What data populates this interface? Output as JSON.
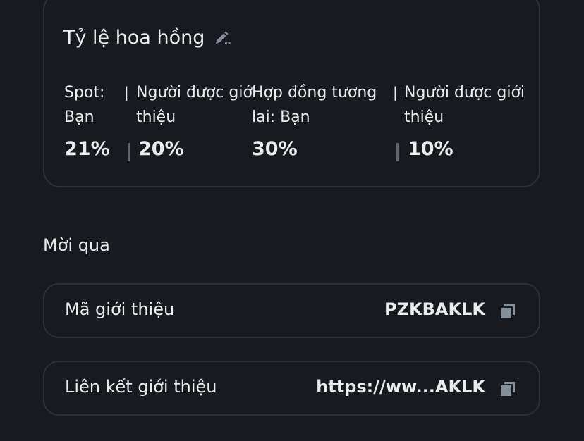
{
  "commission": {
    "title": "Tỷ lệ hoa hồng",
    "edit_icon": "edit-icon",
    "spot_label": "Spot:",
    "spot_you": "Bạn",
    "spot_sep": "|",
    "spot_referred_line1": "Người được giới",
    "spot_referred_line2": "thiệu",
    "spot_you_value": "21%",
    "spot_referred_value": "20%",
    "futures_line1": "Hợp đồng tương",
    "futures_line2": "lai: Bạn",
    "futures_sep": "|",
    "futures_referred_line1": "Người được giới",
    "futures_referred_line2": "thiệu",
    "futures_you_value": "30%",
    "futures_referred_value": "10%"
  },
  "invite": {
    "section_title": "Mời qua",
    "code_label": "Mã giới thiệu",
    "code_value": "PZKBAKLK",
    "link_label": "Liên kết giới thiệu",
    "link_value": "https://ww...AKLK",
    "copy_icon": "copy-icon"
  }
}
